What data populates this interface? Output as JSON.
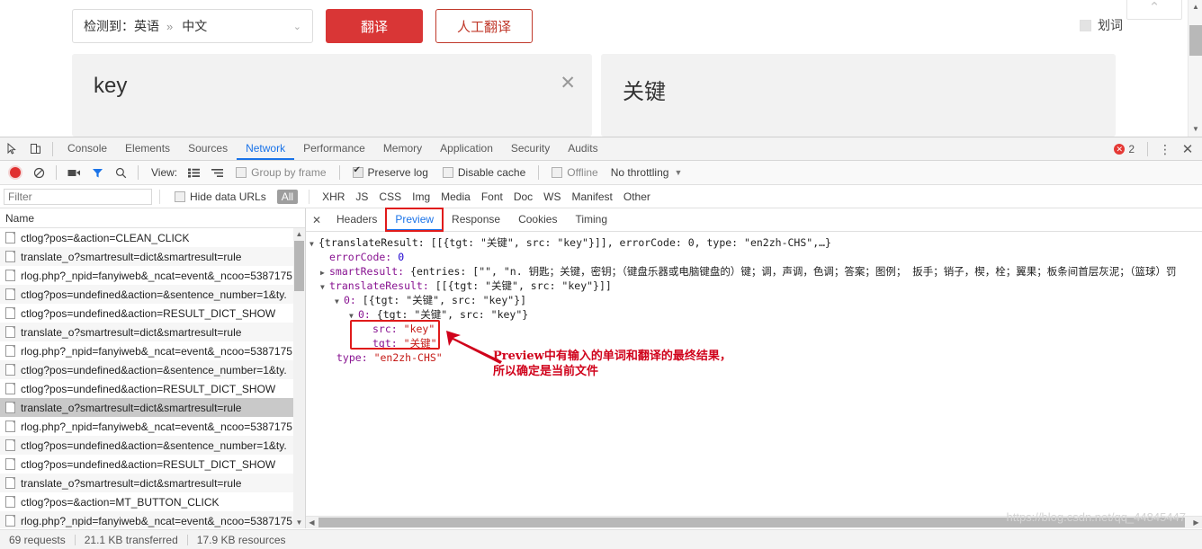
{
  "page": {
    "lang_detected": "检测到：英语",
    "lang_arrows": "»",
    "lang_target": "中文",
    "chevron": "⌄",
    "translate_button": "翻译",
    "human_translate_button": "人工翻译",
    "huaci_label": "划词",
    "source_text": "key",
    "clear_icon": "✕",
    "target_text": "关键",
    "corner_chevron": "⌃",
    "scroll_up": "▲",
    "scroll_down": "▼"
  },
  "devtools": {
    "tabs": [
      "Console",
      "Elements",
      "Sources",
      "Network",
      "Performance",
      "Memory",
      "Application",
      "Security",
      "Audits"
    ],
    "active_tab": "Network",
    "error_count": "2",
    "error_mark": "✕",
    "kebab": "⋮",
    "close": "✕",
    "toolbar": {
      "view_label": "View:",
      "group_by_frame": "Group by frame",
      "preserve_log": "Preserve log",
      "disable_cache": "Disable cache",
      "offline": "Offline",
      "throttling": "No throttling",
      "throttle_arrow": "▼"
    },
    "filterbar": {
      "filter_placeholder": "Filter",
      "filter_value": "",
      "hide_data_urls": "Hide data URLs",
      "types": [
        "All",
        "XHR",
        "JS",
        "CSS",
        "Img",
        "Media",
        "Font",
        "Doc",
        "WS",
        "Manifest",
        "Other"
      ]
    },
    "requests": {
      "header": "Name",
      "selected_index": 9,
      "rows": [
        "ctlog?pos=&action=CLEAN_CLICK",
        "translate_o?smartresult=dict&smartresult=rule",
        "rlog.php?_npid=fanyiweb&_ncat=event&_ncoo=5387175",
        "ctlog?pos=undefined&action=&sentence_number=1&ty.",
        "ctlog?pos=undefined&action=RESULT_DICT_SHOW",
        "translate_o?smartresult=dict&smartresult=rule",
        "rlog.php?_npid=fanyiweb&_ncat=event&_ncoo=5387175",
        "ctlog?pos=undefined&action=&sentence_number=1&ty.",
        "ctlog?pos=undefined&action=RESULT_DICT_SHOW",
        "translate_o?smartresult=dict&smartresult=rule",
        "rlog.php?_npid=fanyiweb&_ncat=event&_ncoo=5387175",
        "ctlog?pos=undefined&action=&sentence_number=1&ty.",
        "ctlog?pos=undefined&action=RESULT_DICT_SHOW",
        "translate_o?smartresult=dict&smartresult=rule",
        "ctlog?pos=&action=MT_BUTTON_CLICK",
        "rlog.php?_npid=fanyiweb&_ncat=event&_ncoo=5387175"
      ]
    },
    "detail": {
      "close_icon": "✕",
      "tabs": [
        "Headers",
        "Preview",
        "Response",
        "Cookies",
        "Timing"
      ],
      "active_tab": "Preview"
    },
    "preview": {
      "line_root_key": "translateResult",
      "line_root": "{translateResult: [[{tgt: \"关键\", src: \"key\"}]], errorCode: 0, type: \"en2zh-CHS\",…}",
      "errorcode_key": "errorCode:",
      "errorcode_val": "0",
      "smartresult_key": "smartResult:",
      "smartresult_val": "{entries: [\"\", \"n. 钥匙；关键，密钥；（键盘乐器或电脑键盘的）键；调，声调，色调；答案；图例； 扳手；销子，楔，栓；翼果；板条间首层灰泥；（篮球）罚",
      "translateresult_key": "translateResult:",
      "translateresult_val": "[[{tgt: \"关键\", src: \"key\"}]]",
      "idx0_key": "0:",
      "idx0_val": "[{tgt: \"关键\", src: \"key\"}]",
      "idx00_key": "0:",
      "idx00_val": "{tgt: \"关键\", src: \"key\"}",
      "src_key": "src:",
      "src_val": "\"key\"",
      "tgt_key": "tgt:",
      "tgt_val": "\"关键\"",
      "type_key": "type:",
      "type_val": "\"en2zh-CHS\""
    },
    "annotation": {
      "line1": "Preview中有输入的单词和翻译的最终结果，",
      "line2": "所以确定是当前文件"
    },
    "status": {
      "requests": "69 requests",
      "transferred": "21.1 KB transferred",
      "resources": "17.9 KB resources"
    },
    "hscroll": {
      "left": "◀",
      "right": "▶"
    }
  },
  "watermark": "https://blog.csdn.net/qq_44845447"
}
